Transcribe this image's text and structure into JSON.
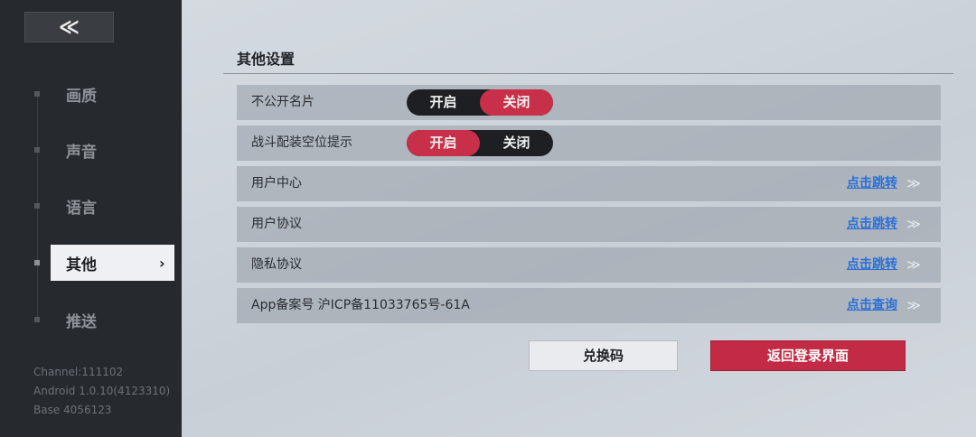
{
  "sidebar": {
    "back_icon": "double-chevron-left-icon",
    "back_glyph": "≪",
    "items": [
      {
        "label": "画质"
      },
      {
        "label": "声音"
      },
      {
        "label": "语言"
      },
      {
        "label": "其他",
        "active": true,
        "chevron": "›"
      },
      {
        "label": "推送"
      }
    ],
    "build_info": {
      "channel": "Channel:111102",
      "android": "Android 1.0.10(4123310)",
      "base": "Base 4056123"
    }
  },
  "main": {
    "section_title": "其他设置",
    "rows": [
      {
        "label": "不公开名片",
        "type": "toggle",
        "on_label": "开启",
        "off_label": "关闭",
        "selected": "关闭"
      },
      {
        "label": "战斗配装空位提示",
        "type": "toggle",
        "on_label": "开启",
        "off_label": "关闭",
        "selected": "开启"
      },
      {
        "label": "用户中心",
        "type": "link",
        "link": "点击跳转",
        "arrows": "≫"
      },
      {
        "label": "用户协议",
        "type": "link",
        "link": "点击跳转",
        "arrows": "≫"
      },
      {
        "label": "隐私协议",
        "type": "link",
        "link": "点击跳转",
        "arrows": "≫"
      },
      {
        "label": "App备案号 沪ICP备11033765号-61A",
        "type": "link",
        "link": "点击查询",
        "arrows": "≫"
      }
    ],
    "buttons": {
      "redeem": "兑换码",
      "back_to_login": "返回登录界面"
    }
  },
  "colors": {
    "accent_red": "#c8304a",
    "sidebar_bg": "#26292e",
    "link_blue": "#2a6fd6"
  }
}
